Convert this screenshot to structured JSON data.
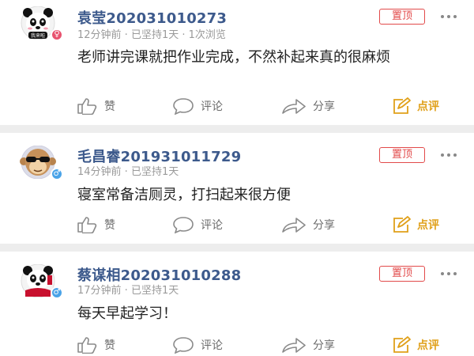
{
  "posts": [
    {
      "name": "袁莹202031010273",
      "meta": "12分钟前 · 已坚持1天 · 1次浏览",
      "pin_label": "置顶",
      "content": "老师讲完课就把作业完成，不然补起来真的很麻烦",
      "avatar_caption": "我来啦",
      "gender": "♀",
      "actions": {
        "like": "赞",
        "comment": "评论",
        "share": "分享",
        "review": "点评"
      }
    },
    {
      "name": "毛昌睿201931011729",
      "meta": "14分钟前 · 已坚持1天",
      "pin_label": "置顶",
      "content": "寝室常备洁厕灵，打扫起来很方便",
      "gender": "♂",
      "actions": {
        "like": "赞",
        "comment": "评论",
        "share": "分享",
        "review": "点评"
      }
    },
    {
      "name": "蔡谋相202031010288",
      "meta": "17分钟前 · 已坚持1天",
      "pin_label": "置顶",
      "content": "每天早起学习！",
      "gender": "♂",
      "actions": {
        "like": "赞",
        "comment": "评论",
        "share": "分享",
        "review": "点评"
      }
    }
  ],
  "colors": {
    "name": "#3d5a8c",
    "pin": "#e24a4a",
    "review": "#e0a01a",
    "meta": "#9a9a9a",
    "divider": "#ededed"
  },
  "icons": {
    "like": "thumbs-up-icon",
    "comment": "comment-bubble-icon",
    "share": "share-arrow-icon",
    "review": "edit-review-icon",
    "more": "more-dots-icon"
  }
}
